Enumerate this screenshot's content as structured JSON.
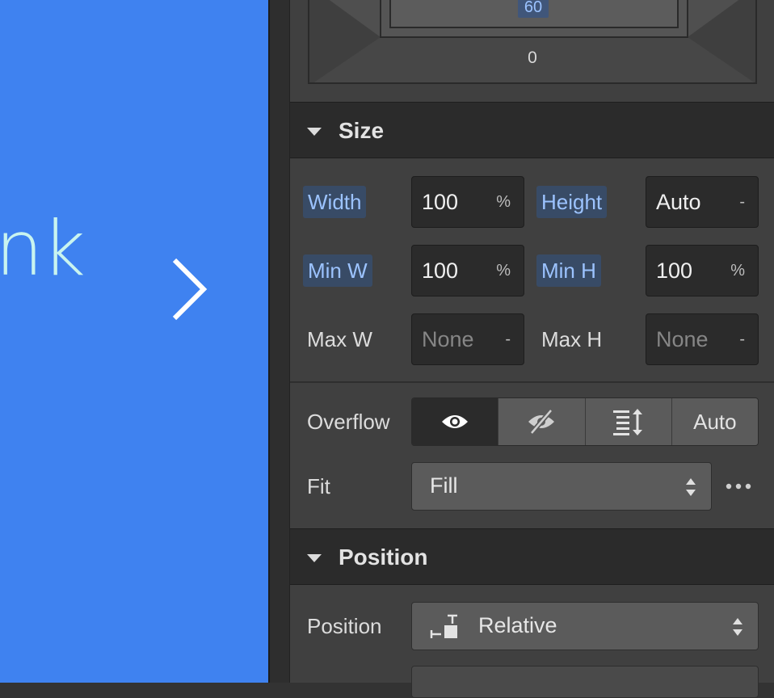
{
  "canvas": {
    "link_text": "nk",
    "bg": "#3f82f0",
    "text_color": "#c9f4ef",
    "chevron_icon": "chevron-right-icon"
  },
  "spacing": {
    "padding_top": "60",
    "margin_bottom": "0"
  },
  "size": {
    "title": "Size",
    "width": {
      "label": "Width",
      "value": "100",
      "unit": "%"
    },
    "height": {
      "label": "Height",
      "value": "Auto",
      "unit": "-"
    },
    "min_w": {
      "label": "Min W",
      "value": "100",
      "unit": "%"
    },
    "min_h": {
      "label": "Min H",
      "value": "100",
      "unit": "%"
    },
    "max_w": {
      "label": "Max W",
      "placeholder": "None",
      "unit": "-"
    },
    "max_h": {
      "label": "Max H",
      "placeholder": "None",
      "unit": "-"
    },
    "overflow": {
      "label": "Overflow",
      "options": [
        "visible-eye-icon",
        "hidden-eye-slash-icon",
        "scroll-icon",
        "Auto"
      ],
      "auto_label": "Auto"
    },
    "fit": {
      "label": "Fit",
      "value": "Fill"
    }
  },
  "position": {
    "title": "Position",
    "label": "Position",
    "value": "Relative"
  },
  "colors": {
    "accent_label_bg": "#384b66",
    "accent_label_text": "#9cc3ff",
    "panel_bg": "#404040",
    "header_bg": "#2b2b2b"
  }
}
